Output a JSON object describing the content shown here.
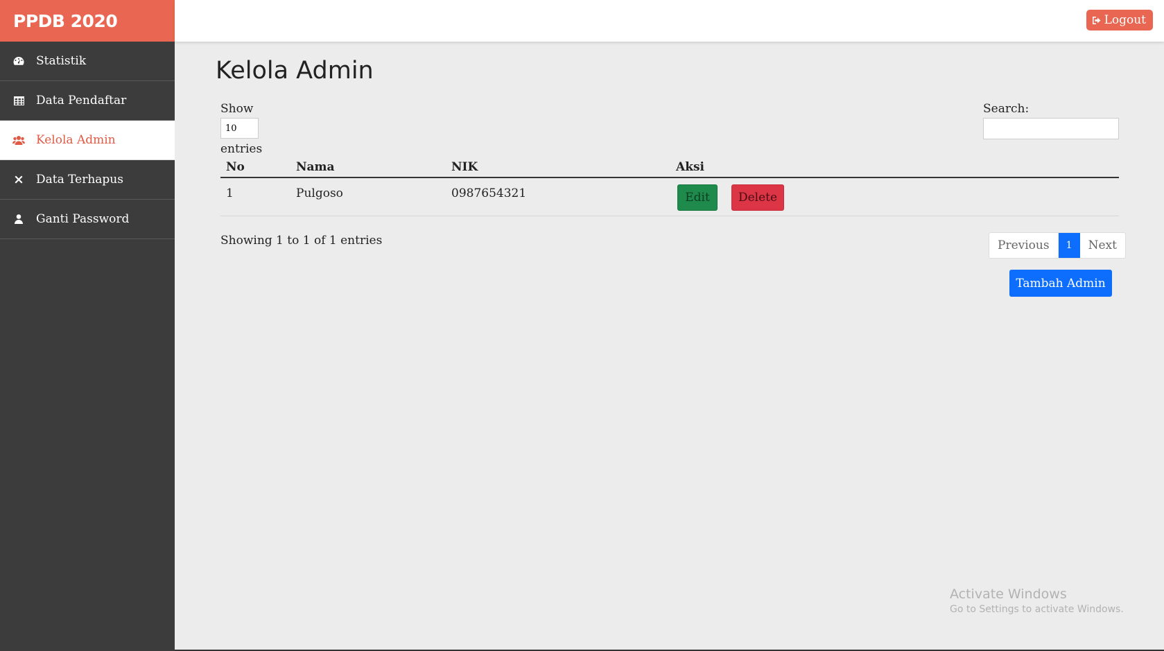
{
  "sidebar": {
    "brand": "PPDB 2020",
    "items": [
      {
        "label": "Statistik",
        "icon": "dashboard-icon"
      },
      {
        "label": "Data Pendaftar",
        "icon": "table-icon"
      },
      {
        "label": "Kelola Admin",
        "icon": "users-icon",
        "active": true
      },
      {
        "label": "Data Terhapus",
        "icon": "close-icon"
      },
      {
        "label": "Ganti Password",
        "icon": "user-icon"
      }
    ]
  },
  "header": {
    "logout_label": "Logout",
    "logout_icon": "sign-out-icon"
  },
  "main": {
    "title": "Kelola Admin",
    "length": {
      "show_label": "Show",
      "value": "10",
      "entries_label": "entries"
    },
    "search": {
      "label": "Search:",
      "value": ""
    },
    "table": {
      "columns": [
        "No",
        "Nama",
        "NIK",
        "Aksi"
      ],
      "rows": [
        {
          "no": "1",
          "nama": "Pulgoso",
          "nik": "0987654321",
          "edit_label": "Edit",
          "delete_label": "Delete"
        }
      ]
    },
    "info": "Showing 1 to 1 of 1 entries",
    "pagination": {
      "previous": "Previous",
      "current": "1",
      "next": "Next"
    },
    "add_button": "Tambah Admin"
  },
  "watermark": {
    "line1": "Activate Windows",
    "line2": "Go to Settings to activate Windows."
  },
  "colors": {
    "brand": "#e96752",
    "sidebar_bg": "#3c3c3c",
    "primary": "#0d6efd",
    "success": "#1e8b4c",
    "danger": "#dc3545"
  }
}
